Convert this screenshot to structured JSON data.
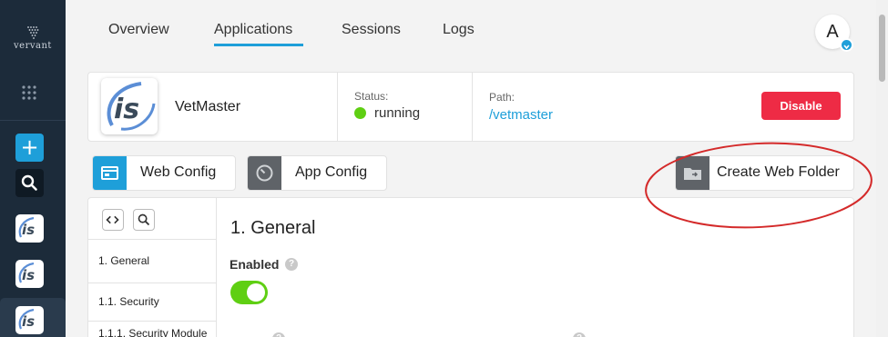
{
  "sidebar": {
    "brand": "vervant",
    "apps": [
      "is-app-1",
      "is-app-2",
      "is-app-3"
    ]
  },
  "nav": {
    "tabs": [
      {
        "label": "Overview"
      },
      {
        "label": "Applications",
        "active": true
      },
      {
        "label": "Sessions"
      },
      {
        "label": "Logs"
      }
    ],
    "avatar_initial": "A"
  },
  "app": {
    "name": "VetMaster",
    "status_label": "Status:",
    "status_value": "running",
    "path_label": "Path:",
    "path_value": "/vetmaster",
    "disable_label": "Disable"
  },
  "config_buttons": {
    "web_config": "Web Config",
    "app_config": "App Config",
    "create_web_folder": "Create Web Folder"
  },
  "config_nav": {
    "items": [
      "1. General",
      "1.1. Security",
      "1.1.1. Security Module"
    ]
  },
  "section": {
    "title": "1. General",
    "enabled_label": "Enabled",
    "enabled": true,
    "help_glyph": "?"
  },
  "colors": {
    "accent": "#1e9fd9",
    "sidebar": "#1c2b3a",
    "danger": "#ee2b45",
    "success": "#5fcf13",
    "annotation": "#d42a2a"
  }
}
